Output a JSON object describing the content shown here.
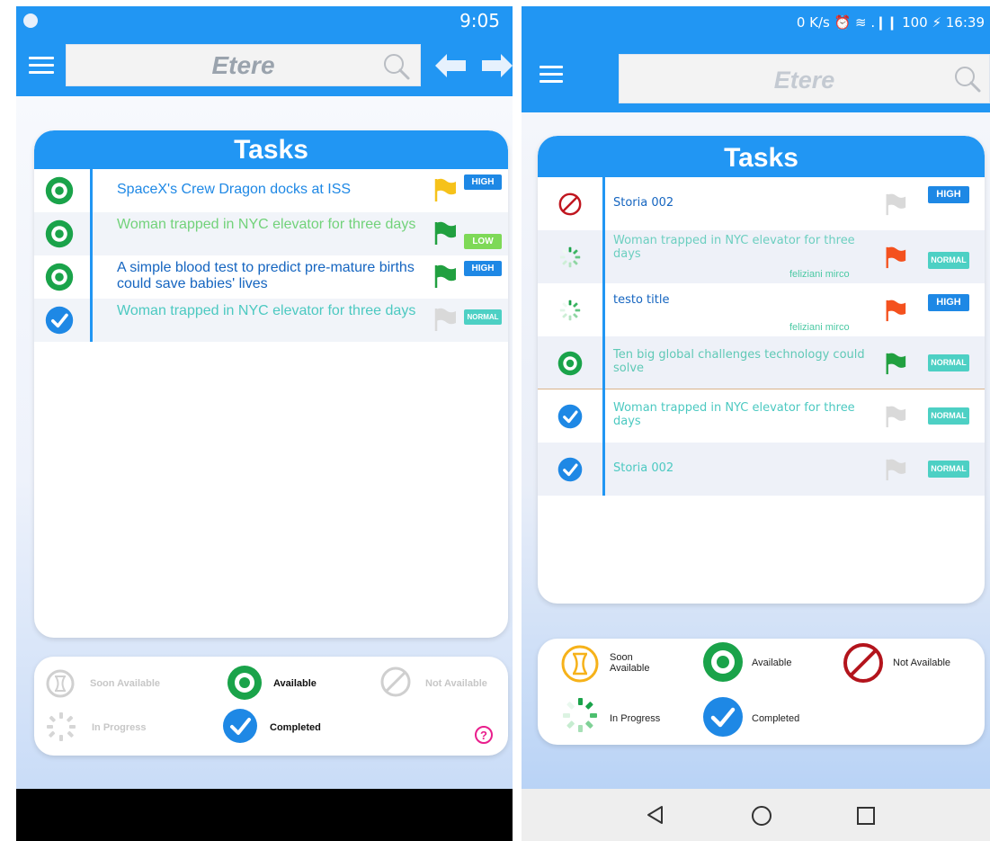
{
  "left": {
    "status": {
      "time": "9:05"
    },
    "app": {
      "brand": "Etere"
    },
    "tasks_title": "Tasks",
    "tasks": [
      {
        "status": "available",
        "status_icon": "available-icon",
        "title": "SpaceX's Crew Dragon docks at ISS",
        "flag_color": "#f6c21a",
        "priority": "HIGH",
        "priority_color": "#1e88e5",
        "text_color": "#1e88e5"
      },
      {
        "status": "available",
        "status_icon": "available-icon",
        "title": "Woman trapped in NYC elevator for three days",
        "flag_color": "#21a040",
        "priority": "LOW",
        "priority_color": "#7ed957",
        "text_color": "#72d27a"
      },
      {
        "status": "available",
        "status_icon": "available-icon",
        "title": "A simple blood test to predict pre-mature births could save babies' lives",
        "flag_color": "#21a040",
        "priority": "HIGH",
        "priority_color": "#1e88e5",
        "text_color": "#1565c0"
      },
      {
        "status": "completed",
        "status_icon": "completed-icon",
        "title": "Woman trapped in NYC elevator for three days",
        "flag_color": "#d9d9d9",
        "priority": "NORMAL",
        "priority_color": "#4dd0c4",
        "text_color": "#4cc9c1"
      }
    ],
    "legend": {
      "soon": "Soon Available",
      "available": "Available",
      "not_available": "Not Available",
      "in_progress": "In Progress",
      "completed": "Completed",
      "help": "?"
    }
  },
  "right": {
    "status": {
      "text": "0 K/s ⏰ ≋ .❙❙ 100 ⚡ 16:39"
    },
    "app": {
      "brand": "Etere"
    },
    "tasks_title": "Tasks",
    "tasks": [
      {
        "status": "not-available",
        "title": "Storia 002",
        "author": "",
        "flag_color": "#d9d9d9",
        "priority": "HIGH",
        "priority_color": "#1e88e5",
        "text_color": "#1565c0"
      },
      {
        "status": "in-progress",
        "title": "Woman trapped in NYC elevator for three days",
        "author": "feliziani mirco",
        "flag_color": "#f4511e",
        "priority": "NORMAL",
        "priority_color": "#4dd0c4",
        "text_color": "#6ccfc0"
      },
      {
        "status": "in-progress",
        "title": "testo title",
        "author": "feliziani mirco",
        "flag_color": "#f4511e",
        "priority": "HIGH",
        "priority_color": "#1e88e5",
        "text_color": "#1565c0"
      },
      {
        "status": "available",
        "title": "Ten big global challenges technology could solve",
        "author": "",
        "flag_color": "#21a040",
        "priority": "NORMAL",
        "priority_color": "#4dd0c4",
        "text_color": "#5fc9b6"
      },
      {
        "status": "completed",
        "title": "Woman trapped in NYC elevator for three days",
        "author": "",
        "flag_color": "#d9d9d9",
        "priority": "NORMAL",
        "priority_color": "#4dd0c4",
        "text_color": "#4cc9c1"
      },
      {
        "status": "completed",
        "title": "Storia 002",
        "author": "",
        "flag_color": "#d9d9d9",
        "priority": "NORMAL",
        "priority_color": "#4dd0c4",
        "text_color": "#4cc9c1"
      }
    ],
    "legend": {
      "soon": "Soon Available",
      "available": "Available",
      "not_available": "Not Available",
      "in_progress": "In Progress",
      "completed": "Completed"
    }
  },
  "colors": {
    "primary": "#2196f3",
    "available_green": "#1aa34a",
    "not_available_red": "#c0161f",
    "soon_orange": "#f6b21a"
  }
}
